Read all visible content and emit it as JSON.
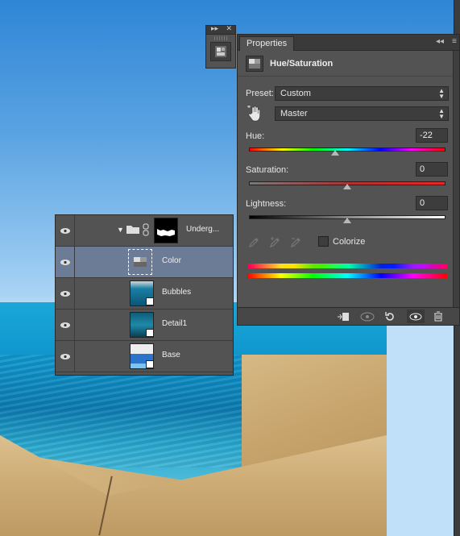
{
  "mini_panel": {
    "collapse_glyph": "▸▸",
    "close_glyph": "✕",
    "tool_icon": "properties-cube-icon"
  },
  "properties": {
    "tab_label": "Properties",
    "collapse_glyph": "◂◂",
    "menu_glyph": "≡",
    "adjustment_title": "Hue/Saturation",
    "preset_label": "Preset:",
    "preset_value": "Custom",
    "channel_value": "Master",
    "hue_label": "Hue:",
    "hue_value": "-22",
    "hue_level": -22,
    "saturation_label": "Saturation:",
    "saturation_value": "0",
    "saturation_level": 0,
    "lightness_label": "Lightness:",
    "lightness_value": "0",
    "lightness_level": 0,
    "colorize_label": "Colorize",
    "colorize_checked": false
  },
  "layers": [
    {
      "name": "Underg...",
      "type": "group",
      "visible": true,
      "selected": false
    },
    {
      "name": "Color",
      "type": "adjustment",
      "visible": true,
      "selected": true
    },
    {
      "name": "Bubbles",
      "type": "smart-object",
      "visible": true,
      "selected": false
    },
    {
      "name": "Detail1",
      "type": "smart-object",
      "visible": true,
      "selected": false
    },
    {
      "name": "Base",
      "type": "smart-object",
      "visible": true,
      "selected": false
    }
  ],
  "colors": {
    "panel": "#535353",
    "panel_dark": "#3a3a3a",
    "selection": "#6d7c96"
  }
}
